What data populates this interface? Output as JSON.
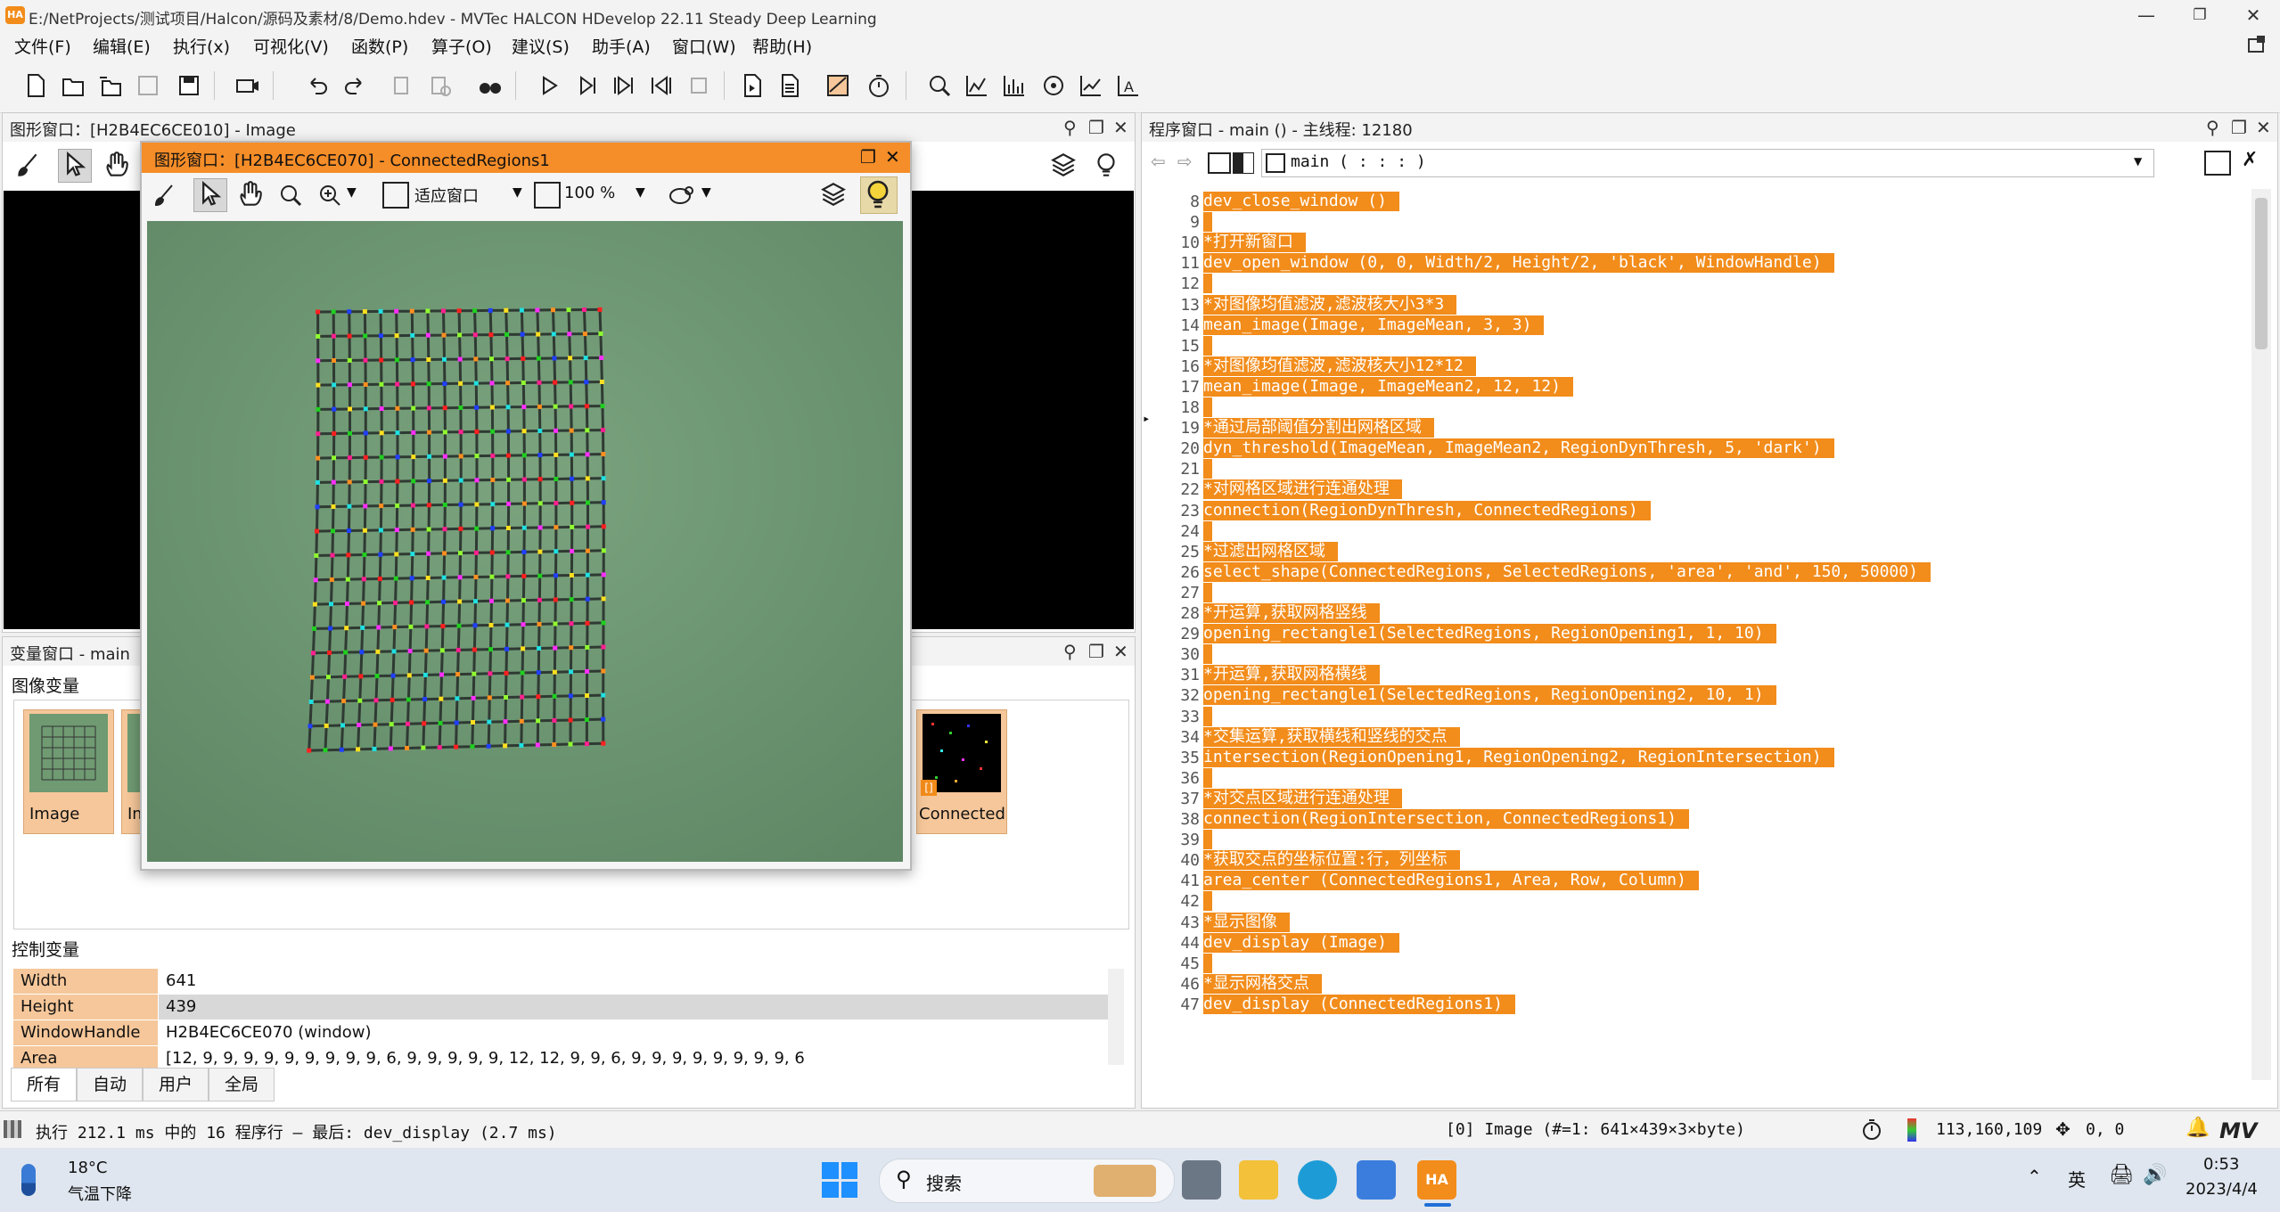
{
  "window": {
    "title": "E:/NetProjects/测试项目/Halcon/源码及素材/8/Demo.hdev - MVTec HALCON HDevelop 22.11 Steady Deep Learning",
    "logo_text": "HA"
  },
  "menu": [
    "文件(F)",
    "编辑(E)",
    "执行(x)",
    "可视化(V)",
    "函数(P)",
    "算子(O)",
    "建议(S)",
    "助手(A)",
    "窗口(W)",
    "帮助(H)"
  ],
  "graphics_window": {
    "title": "图形窗口：[H2B4EC6CE010] - Image"
  },
  "float_window": {
    "title": "图形窗口：[H2B4EC6CE070] - ConnectedRegions1",
    "fit_label": "适应窗口",
    "zoom_label": "100 %"
  },
  "variable_window": {
    "title": "变量窗口 - main",
    "image_vars_label": "图像变量",
    "thumbs": [
      "Image",
      "Im",
      "ConnectedR"
    ],
    "thumb_badge": "[]",
    "control_vars_label": "控制变量",
    "control_vars": [
      {
        "name": "Width",
        "value": "641"
      },
      {
        "name": "Height",
        "value": "439"
      },
      {
        "name": "WindowHandle",
        "value": "H2B4EC6CE070 (window)"
      },
      {
        "name": "Area",
        "value": "[12, 9, 9, 9, 9, 9, 9, 9, 9, 9, 6, 9, 9, 9, 9, 9, 12, 12, 9, 9, 6, 9, 9, 9, 9, 9, 9, 9, 9, 6"
      }
    ],
    "tabs": [
      "所有",
      "自动",
      "用户",
      "全局"
    ]
  },
  "program_window": {
    "title": "程序窗口 - main () - 主线程: 12180",
    "procedure": "main ( : : : )",
    "lines": [
      {
        "n": "8",
        "t": "dev_close_window ()"
      },
      {
        "n": "9",
        "t": ""
      },
      {
        "n": "10",
        "t": "*打开新窗口"
      },
      {
        "n": "11",
        "t": "dev_open_window (0, 0, Width/2, Height/2, 'black', WindowHandle)"
      },
      {
        "n": "12",
        "t": ""
      },
      {
        "n": "13",
        "t": "*对图像均值滤波,滤波核大小3*3"
      },
      {
        "n": "14",
        "t": "mean_image(Image, ImageMean, 3, 3)"
      },
      {
        "n": "15",
        "t": ""
      },
      {
        "n": "16",
        "t": "*对图像均值滤波,滤波核大小12*12"
      },
      {
        "n": "17",
        "t": "mean_image(Image, ImageMean2, 12, 12)"
      },
      {
        "n": "18",
        "t": ""
      },
      {
        "n": "19",
        "t": "*通过局部阈值分割出网格区域"
      },
      {
        "n": "20",
        "t": "dyn_threshold(ImageMean, ImageMean2, RegionDynThresh, 5, 'dark')"
      },
      {
        "n": "21",
        "t": ""
      },
      {
        "n": "22",
        "t": "*对网格区域进行连通处理"
      },
      {
        "n": "23",
        "t": "connection(RegionDynThresh, ConnectedRegions)"
      },
      {
        "n": "24",
        "t": ""
      },
      {
        "n": "25",
        "t": "*过滤出网格区域"
      },
      {
        "n": "26",
        "t": "select_shape(ConnectedRegions, SelectedRegions, 'area', 'and', 150, 50000)"
      },
      {
        "n": "27",
        "t": ""
      },
      {
        "n": "28",
        "t": "*开运算,获取网格竖线"
      },
      {
        "n": "29",
        "t": "opening_rectangle1(SelectedRegions, RegionOpening1, 1, 10)"
      },
      {
        "n": "30",
        "t": ""
      },
      {
        "n": "31",
        "t": "*开运算,获取网格横线"
      },
      {
        "n": "32",
        "t": "opening_rectangle1(SelectedRegions, RegionOpening2, 10, 1)"
      },
      {
        "n": "33",
        "t": ""
      },
      {
        "n": "34",
        "t": "*交集运算,获取横线和竖线的交点"
      },
      {
        "n": "35",
        "t": "intersection(RegionOpening1, RegionOpening2, RegionIntersection)"
      },
      {
        "n": "36",
        "t": ""
      },
      {
        "n": "37",
        "t": "*对交点区域进行连通处理"
      },
      {
        "n": "38",
        "t": "connection(RegionIntersection, ConnectedRegions1)"
      },
      {
        "n": "39",
        "t": ""
      },
      {
        "n": "40",
        "t": "*获取交点的坐标位置:行，列坐标"
      },
      {
        "n": "41",
        "t": "area_center (ConnectedRegions1, Area, Row, Column)"
      },
      {
        "n": "42",
        "t": ""
      },
      {
        "n": "43",
        "t": "*显示图像"
      },
      {
        "n": "44",
        "t": "dev_display (Image)"
      },
      {
        "n": "45",
        "t": ""
      },
      {
        "n": "46",
        "t": "*显示网格交点"
      },
      {
        "n": "47",
        "t": "dev_display (ConnectedRegions1)"
      }
    ]
  },
  "status": {
    "exec": "执行 212.1 ms 中的 16 程序行 — 最后: dev_display (2.7 ms)",
    "image_info": "[0] Image (#=1: 641×439×3×byte)",
    "pixel": "113,160,109",
    "coords": "0, 0"
  },
  "taskbar": {
    "temperature": "18°C",
    "weather": "气温下降",
    "search": "搜索",
    "ime": "英",
    "time": "0:53",
    "date": "2023/4/4"
  },
  "colors": {
    "accent": "#f28c1b",
    "code_highlight": "#f28c1b",
    "thumb": "#f6c79a"
  }
}
